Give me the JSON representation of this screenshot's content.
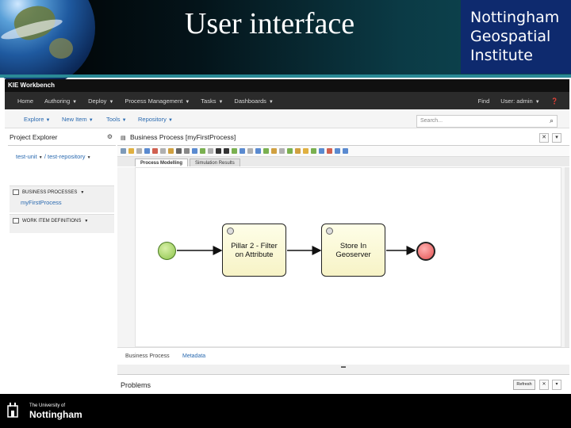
{
  "slide": {
    "title": "User interface",
    "logo_lines": [
      "Nottingham",
      "Geospatial",
      "Institute"
    ],
    "footer_small": "The University of",
    "footer_name": "Nottingham"
  },
  "app": {
    "brand": "KIE Workbench",
    "nav": [
      "Home",
      "Authoring",
      "Deploy",
      "Process Management",
      "Tasks",
      "Dashboards"
    ],
    "find": "Find",
    "user": "User: admin",
    "menu": [
      "Explore",
      "New Item",
      "Tools",
      "Repository"
    ],
    "search_placeholder": "Search..."
  },
  "project_explorer": {
    "title": "Project Explorer",
    "breadcrumb": [
      "test-unit",
      "/",
      "test-repository"
    ],
    "sections": [
      {
        "title": "BUSINESS PROCESSES",
        "items": [
          "myFirstProcess"
        ]
      },
      {
        "title": "WORK ITEM DEFINITIONS",
        "items": []
      }
    ]
  },
  "editor": {
    "title": "Business Process [myFirstProcess]",
    "tabs": [
      "Process Modelling",
      "Simulation Results"
    ],
    "active_tab": "Process Modelling",
    "tasks": [
      "Pillar 2 - Filter on Attribute",
      "Store In Geoserver"
    ],
    "task1_lines": [
      "Pillar 2 - Filter",
      "on Attribute"
    ],
    "task2_lines": [
      "Store In",
      "Geoserver"
    ],
    "bottom_tabs": [
      "Business Process",
      "Metadata"
    ]
  },
  "problems": {
    "title": "Problems",
    "refresh_label": "Refresh"
  },
  "colors": {
    "header_bg": "#000000",
    "logo_bg": "#0e2a6e",
    "accent_rule": "#2a8a96",
    "start_event": "#8cc44a",
    "end_event": "#e25050",
    "task_fill": "#f7f3c6",
    "link": "#2a6ab0"
  }
}
